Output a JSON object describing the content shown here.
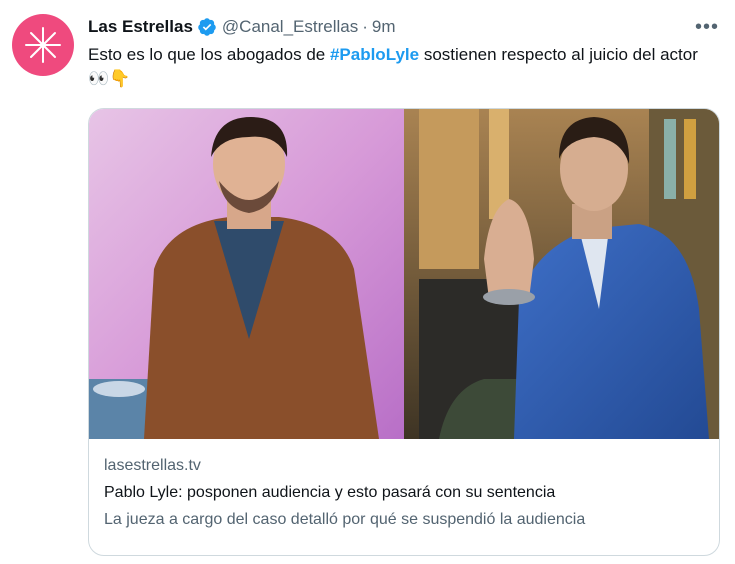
{
  "author": {
    "name": "Las Estrellas",
    "handle": "@Canal_Estrellas",
    "separator": "·",
    "time": "9m",
    "verified": true,
    "avatar_color": "#ef4a7e"
  },
  "more_label": "•••",
  "tweet": {
    "text_before": "Esto es lo que los abogados de ",
    "hashtag": "#PabloLyle",
    "text_after": " sostienen respecto al juicio del actor ",
    "emojis": "👀👇"
  },
  "card": {
    "domain": "lasestrellas.tv",
    "title": "Pablo Lyle: posponen audiencia y esto pasará con su sentencia",
    "description": "La jueza a cargo del caso detalló por qué se suspendió la audiencia"
  },
  "colors": {
    "accent": "#1d9bf0",
    "secondary_text": "#536471",
    "border": "#cfd9de"
  }
}
